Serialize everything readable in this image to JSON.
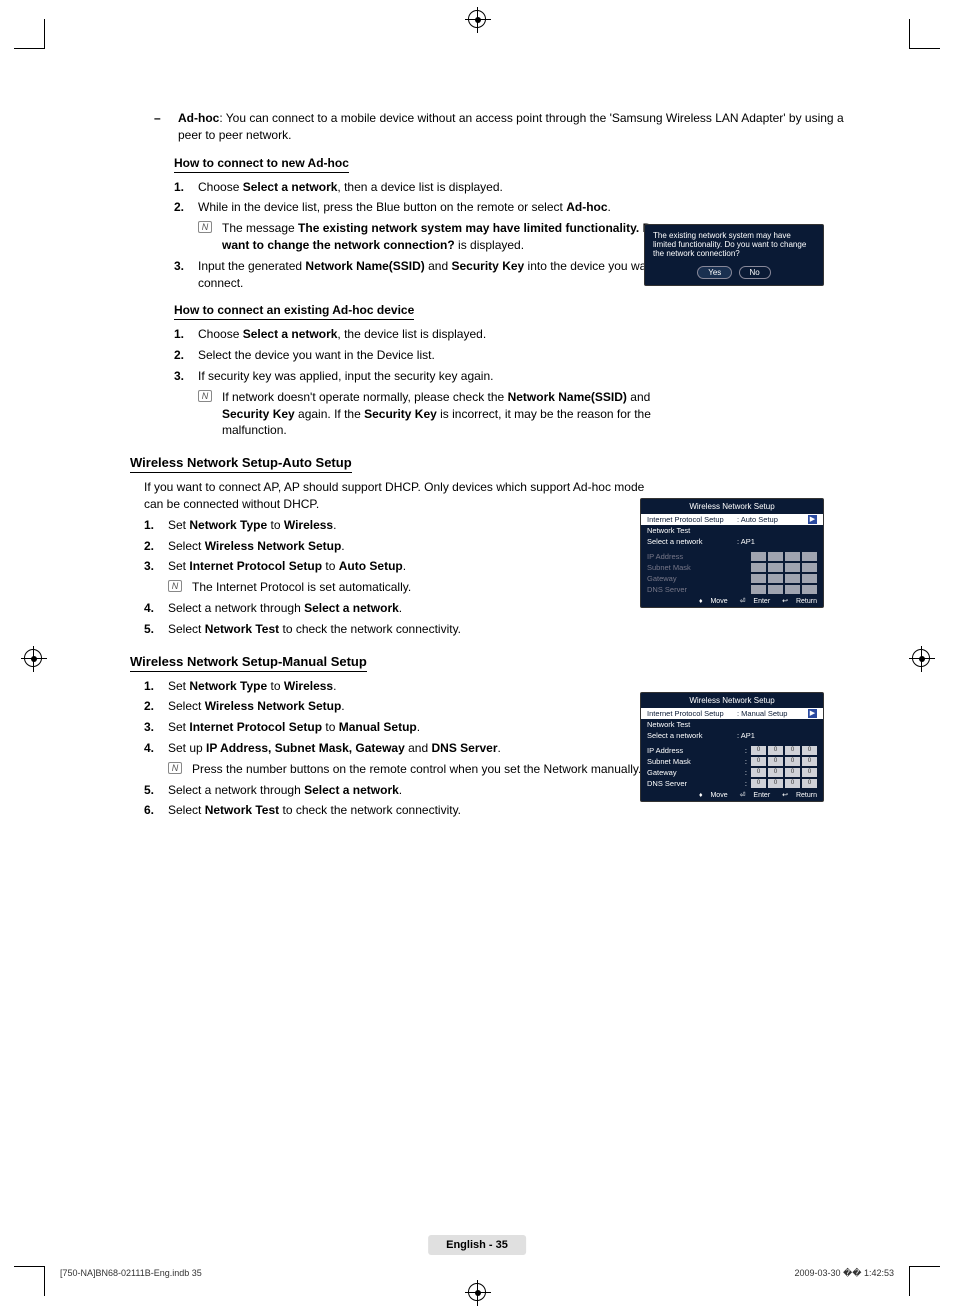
{
  "adhoc": {
    "label": "Ad-hoc",
    "desc": ": You can connect to a mobile device without an access point through the 'Samsung Wireless LAN Adapter' by using a peer to peer network."
  },
  "newAdhoc": {
    "title": "How to connect to new Ad-hoc",
    "steps": [
      {
        "n": "1.",
        "pre": "Choose ",
        "b": "Select a network",
        "post": ", then a device list is displayed."
      },
      {
        "n": "2.",
        "pre": "While in the device list, press the Blue button on the remote or select ",
        "b": "Ad-hoc",
        "post": "."
      },
      {
        "n": "3.",
        "pre": "Input the generated ",
        "b": "Network Name(SSID)",
        "mid": " and ",
        "b2": "Security Key",
        "post": " into the device you want to connect."
      }
    ],
    "note_pre": "The message ",
    "note_b": "The existing network system may have limited functionality. Do you want to change the network connection?",
    "note_post": " is displayed."
  },
  "existAdhoc": {
    "title": "How to connect an existing Ad-hoc device",
    "steps": [
      {
        "n": "1.",
        "pre": "Choose ",
        "b": "Select a network",
        "post": ", the device list is displayed."
      },
      {
        "n": "2.",
        "text": "Select the device you want in the Device list."
      },
      {
        "n": "3.",
        "text": "If security key was applied, input the security key again."
      }
    ],
    "note_pre": "If network doesn't operate normally, please check the ",
    "note_b1": "Network Name(SSID)",
    "note_mid": " and ",
    "note_b2": "Security Key",
    "note_mid2": " again. If the ",
    "note_b3": "Security Key",
    "note_post": " is incorrect, it may be the reason for the malfunction."
  },
  "autoSetup": {
    "title": "Wireless Network Setup-Auto Setup",
    "lead": "If you want to connect AP, AP should support DHCP. Only devices which support Ad-hoc mode can be connected without DHCP.",
    "steps": [
      {
        "n": "1.",
        "pre": "Set ",
        "b": "Network Type",
        "mid": " to ",
        "b2": "Wireless",
        "post": "."
      },
      {
        "n": "2.",
        "pre": "Select ",
        "b": "Wireless Network Setup",
        "post": "."
      },
      {
        "n": "3.",
        "pre": "Set ",
        "b": "Internet Protocol Setup",
        "mid": " to ",
        "b2": "Auto Setup",
        "post": "."
      },
      {
        "n": "4.",
        "pre": "Select a network through ",
        "b": "Select a network",
        "post": "."
      },
      {
        "n": "5.",
        "pre": "Select ",
        "b": "Network Test",
        "post": " to check the network connectivity."
      }
    ],
    "note": "The Internet Protocol is set automatically."
  },
  "manualSetup": {
    "title": "Wireless Network Setup-Manual Setup",
    "steps": [
      {
        "n": "1.",
        "pre": "Set ",
        "b": "Network Type",
        "mid": " to ",
        "b2": "Wireless",
        "post": "."
      },
      {
        "n": "2.",
        "pre": "Select ",
        "b": "Wireless Network Setup",
        "post": "."
      },
      {
        "n": "3.",
        "pre": "Set ",
        "b": "Internet Protocol Setup",
        "mid": " to ",
        "b2": "Manual Setup",
        "post": "."
      },
      {
        "n": "4.",
        "pre": "Set up ",
        "b": "IP Address, Subnet Mask, Gateway",
        "mid": " and ",
        "b2": "DNS Server",
        "post": "."
      },
      {
        "n": "5.",
        "pre": "Select a network through ",
        "b": "Select a network",
        "post": "."
      },
      {
        "n": "6.",
        "pre": "Select ",
        "b": "Network Test",
        "post": " to check the network connectivity."
      }
    ],
    "note": "Press the number buttons on the remote control when you set the Network manually."
  },
  "dialog": {
    "msg": "The existing network system may have limited functionality. Do you want to change the network connection?",
    "yes": "Yes",
    "no": "No"
  },
  "tv": {
    "title": "Wireless Network Setup",
    "ips": "Internet Protocol Setup",
    "auto": ": Auto Setup",
    "manual": ": Manual Setup",
    "ntest": "Network Test",
    "selnet": "Select a network",
    "ap": ": AP1",
    "ipaddr": "IP Address",
    "subnet": "Subnet Mask",
    "gateway": "Gateway",
    "dns": "DNS Server",
    "zero": "0",
    "move": "Move",
    "enter": "Enter",
    "return": "Return",
    "arrow": "▶",
    "diamond": "♦",
    "enterIcon": "⏎",
    "retIcon": "↩"
  },
  "pagefoot": "English - 35",
  "docfoot_left": "[750-NA]BN68-02111B-Eng.indb   35",
  "docfoot_right": "2009-03-30   �� 1:42:53"
}
